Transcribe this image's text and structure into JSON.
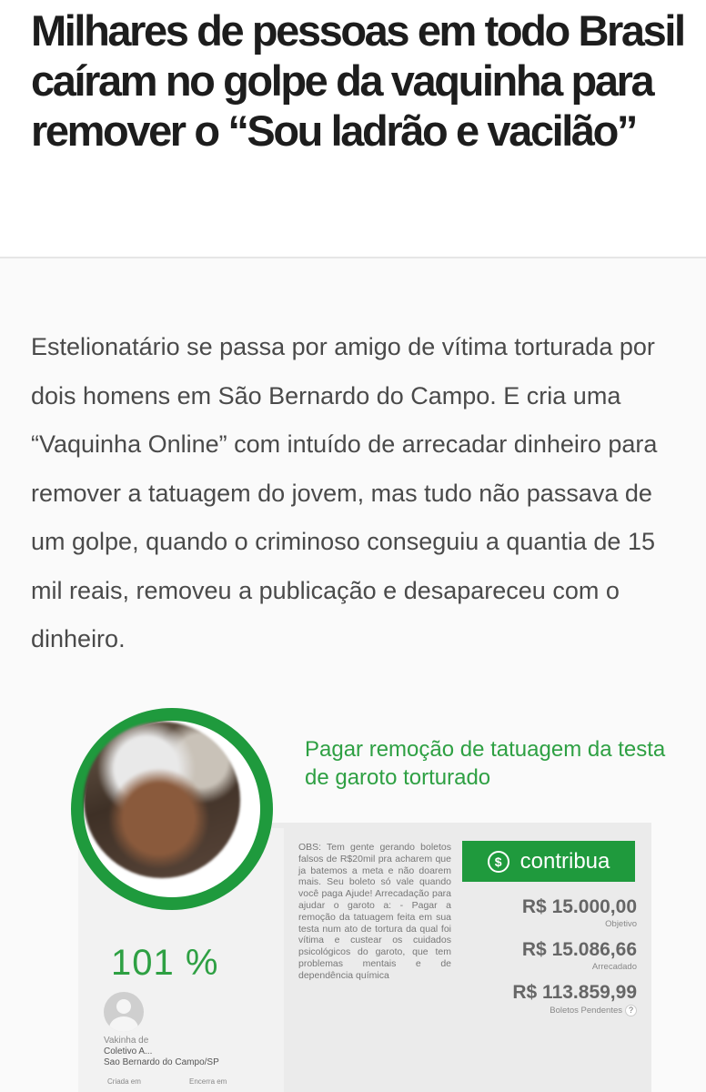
{
  "article": {
    "headline": "Milhares de pessoas em todo Brasil caíram no golpe da vaquinha para remover o “Sou ladrão e vacilão”",
    "lead": "Estelionatário se passa por amigo de vítima torturada por dois homens em São Bernardo do Campo. E cria uma “Vaquinha Online” com intuído de arrecadar dinheiro para remover a tatuagem do jovem, mas tudo não passava de um golpe, quando o criminoso conseguiu a quantia de 15 mil reais, removeu a publicação e desapareceu com o dinheiro."
  },
  "campaign": {
    "title": "Pagar remoção de tatuagem da testa de garoto torturado",
    "percent": "101 %",
    "progress_fraction": 1.01,
    "obs": "OBS: Tem gente gerando boletos falsos de R$20mil pra acharem que ja batemos a meta e não doarem mais. Seu boleto só vale quando você paga Ajude! Arrecadação para ajudar o garoto a: - Pagar a remoção da tatuagem feita em sua testa num ato de tortura da qual foi vítima e custear os cuidados psicológicos do garoto, que tem problemas mentais e de dependência química",
    "contribute_label": "contribua",
    "goal_amount": "R$ 15.000,00",
    "goal_caption": "Objetivo",
    "raised_amount": "R$ 15.086,66",
    "raised_caption": "Arrecadado",
    "pending_amount": "R$ 113.859,99",
    "pending_caption": "Boletos Pendentes",
    "help_symbol": "?",
    "creator_by": "Vakinha de",
    "creator_name": "Coletivo A...",
    "creator_location": "Sao Bernardo do Campo/SP",
    "created_label": "Criada em",
    "ends_label": "Encerra em",
    "accent_color": "#1f9a3d"
  }
}
